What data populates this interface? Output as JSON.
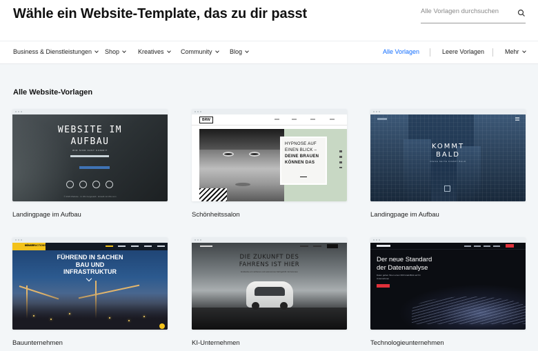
{
  "header": {
    "title": "Wähle ein Website-Template, das zu dir passt",
    "search_placeholder": "Alle Vorlagen durchsuchen"
  },
  "nav": {
    "categories": [
      {
        "label": "Business & Dienstleistungen"
      },
      {
        "label": "Shop"
      },
      {
        "label": "Kreatives"
      },
      {
        "label": "Community"
      },
      {
        "label": "Blog"
      }
    ],
    "all_templates": "Alle Vorlagen",
    "blank_templates": "Leere Vorlagen",
    "more": "Mehr",
    "colors": {
      "active": "#116dff"
    }
  },
  "section": {
    "title": "Alle Website-Vorlagen"
  },
  "templates": [
    {
      "name": "Landingpage im Aufbau",
      "preview": {
        "headline_1": "WEBSITE IM",
        "headline_2": "AUFBAU",
        "subline": "WIR SIND FAST KOMMIT",
        "footer": "© 2023 Website · In Wix hergestellt · Erstellt mit Wix.com"
      }
    },
    {
      "name": "Schönheitssalon",
      "preview": {
        "logo": "BRW",
        "text_1": "HYPNOSE AUF",
        "text_2": "EINEN BLICK –",
        "text_3": "DEINE BRAUEN",
        "text_4": "KÖNNEN DAS"
      }
    },
    {
      "name": "Landingpage im Aufbau",
      "preview": {
        "headline_1": "KOMMT",
        "headline_2": "BALD",
        "subline": "DIESE SEITE KOMMT BALD"
      }
    },
    {
      "name": "Bauunternehmen",
      "preview": {
        "logo_1": "MÜLLER",
        "logo_2": "CONSTRUCTIONS",
        "headline_1": "FÜHREND IN SACHEN",
        "headline_2": "BAU UND",
        "headline_3": "INFRASTRUKTUR"
      }
    },
    {
      "name": "KI-Unternehmen",
      "preview": {
        "headline_1": "DIE ZUKUNFT DES",
        "headline_2": "FAHRENS IST HIER",
        "subline": "Entdecke ein sicheres und autonomes Fahrgefühl mit Autoneo"
      }
    },
    {
      "name": "Technologieunternehmen",
      "preview": {
        "headline_1": "Der neue Standard",
        "headline_2": "der Datenanalyse",
        "subline": "Daten geben Ihnen einen 360 Grad-Blick auf Ihr Unternehmen"
      }
    }
  ]
}
